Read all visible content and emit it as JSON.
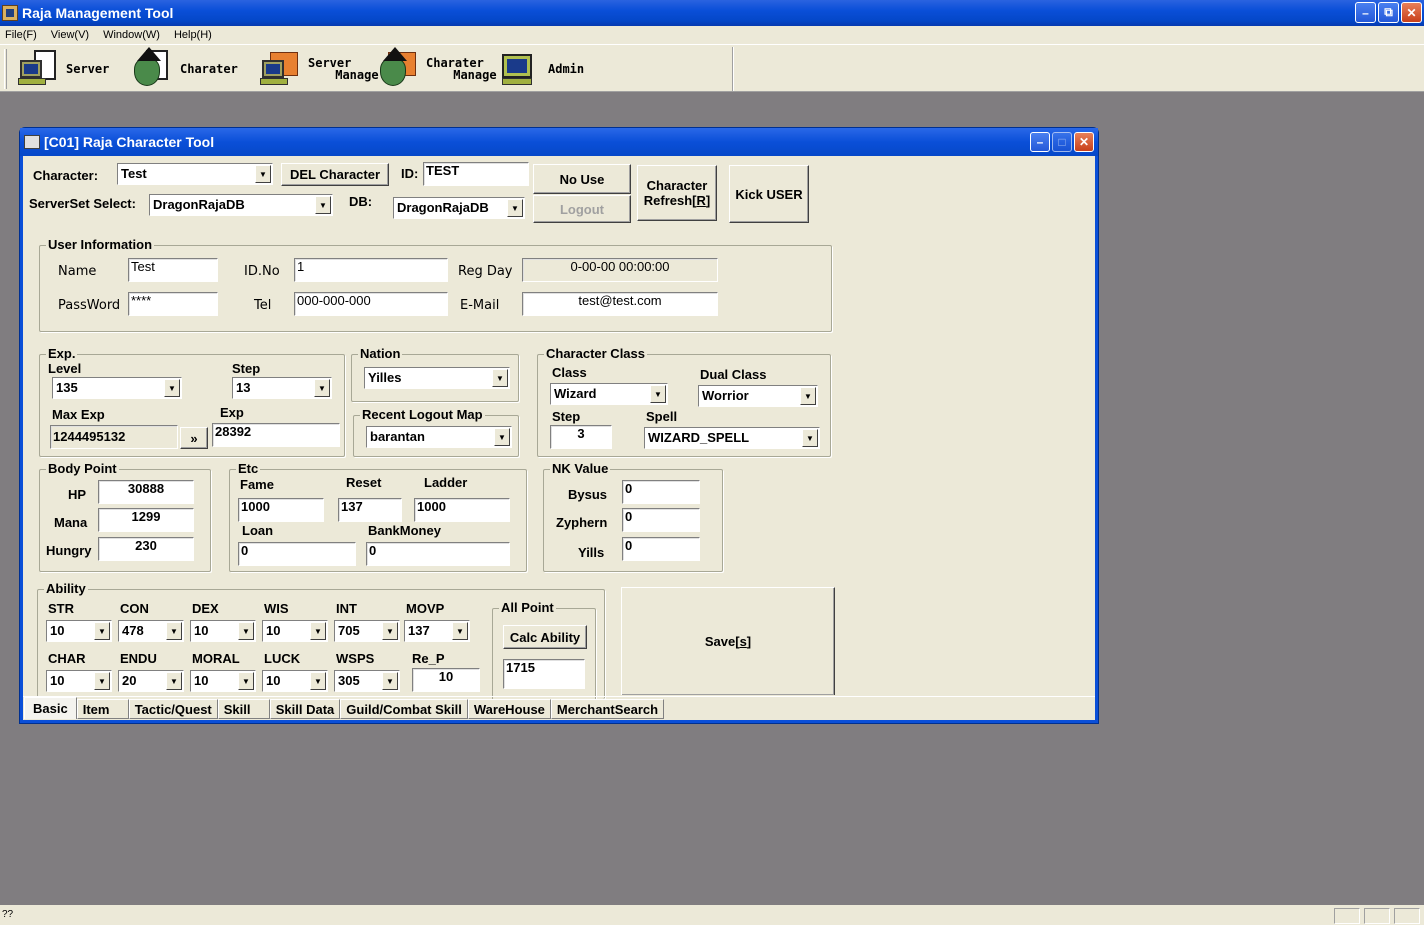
{
  "app": {
    "title": "Raja Management Tool",
    "window_buttons": {
      "minimize": "–",
      "restore": "⧉",
      "close": "✕"
    }
  },
  "menu": [
    "File(F)",
    "View(V)",
    "Window(W)",
    "Help(H)"
  ],
  "toolbar": [
    {
      "label": "Server",
      "icon": "server-computer-icon"
    },
    {
      "label": "Charater",
      "icon": "witch-document-icon"
    },
    {
      "label": "Server\nManage",
      "line1": "Server",
      "line2": " Manage",
      "icon": "server-manage-icon"
    },
    {
      "label": "Charater\nManage",
      "line1": "Charater",
      "line2": " Manage",
      "icon": "character-manage-icon"
    },
    {
      "label": "Admin",
      "icon": "admin-key-icon"
    }
  ],
  "child_window": {
    "title": "[C01] Raja Character Tool",
    "header": {
      "character_label": "Character:",
      "character_value": "Test",
      "del_character": "DEL Character",
      "id_label": "ID:",
      "id_value": "TEST",
      "no_use": "No Use",
      "logout": "Logout",
      "refresh_line1": "Character",
      "refresh_line2": "Refresh[",
      "refresh_key": "R",
      "refresh_end": "]",
      "kick_user": "Kick USER",
      "serverset_label": "ServerSet Select:",
      "serverset_value": "DragonRajaDB",
      "db_label": "DB:",
      "db_value": "DragonRajaDB"
    },
    "user_info": {
      "title": "User Information",
      "name_label": "Name",
      "name": "Test",
      "idno_label": "ID.No",
      "idno": "1",
      "regday_label": "Reg Day",
      "regday": "0-00-00 00:00:00",
      "password_label": "PassWord",
      "password": "****",
      "tel_label": "Tel",
      "tel": "000-000-000",
      "email_label": "E-Mail",
      "email": "test@test.com"
    },
    "exp": {
      "title": "Exp.",
      "level_label": "Level",
      "level": "135",
      "step_label": "Step",
      "step": "13",
      "maxexp_label": "Max Exp",
      "maxexp": "1244495132",
      "arrow_button": "»",
      "exp_label": "Exp",
      "exp": "28392"
    },
    "nation": {
      "title": "Nation",
      "value": "Yilles"
    },
    "logout_map": {
      "title": "Recent Logout Map",
      "value": "barantan"
    },
    "char_class": {
      "title": "Character Class",
      "class_label": "Class",
      "class": "Wizard",
      "dual_label": "Dual Class",
      "dual": "Worrior",
      "step_label": "Step",
      "step": "3",
      "spell_label": "Spell",
      "spell": "WIZARD_SPELL"
    },
    "body_point": {
      "title": "Body Point",
      "hp_label": "HP",
      "hp": "30888",
      "mana_label": "Mana",
      "mana": "1299",
      "hungry_label": "Hungry",
      "hungry": "230"
    },
    "etc": {
      "title": "Etc",
      "fame_label": "Fame",
      "fame": "1000",
      "reset_label": "Reset",
      "reset": "137",
      "ladder_label": "Ladder",
      "ladder": "1000",
      "loan_label": "Loan",
      "loan": "0",
      "bank_label": "BankMoney",
      "bank": "0"
    },
    "nk": {
      "title": "NK Value",
      "bysus_label": "Bysus",
      "bysus": "0",
      "zyphern_label": "Zyphern",
      "zyphern": "0",
      "yills_label": "Yills",
      "yills": "0"
    },
    "ability": {
      "title": "Ability",
      "row1": [
        {
          "label": "STR",
          "value": "10"
        },
        {
          "label": "CON",
          "value": "478"
        },
        {
          "label": "DEX",
          "value": "10"
        },
        {
          "label": "WIS",
          "value": "10"
        },
        {
          "label": "INT",
          "value": "705"
        },
        {
          "label": "MOVP",
          "value": "137"
        }
      ],
      "row2": [
        {
          "label": "CHAR",
          "value": "10"
        },
        {
          "label": "ENDU",
          "value": "20"
        },
        {
          "label": "MORAL",
          "value": "10"
        },
        {
          "label": "LUCK",
          "value": "10"
        },
        {
          "label": "WSPS",
          "value": "305"
        }
      ],
      "rep_label": "Re_P",
      "rep": "10"
    },
    "all_point": {
      "title": "All Point",
      "calc_button": "Calc Ability",
      "value": "1715"
    },
    "save": {
      "label": "Save[",
      "key": "s",
      "end": "]"
    },
    "tabs": [
      "Basic",
      "Item",
      "Tactic/Quest",
      "Skill",
      "Skill Data",
      "Guild/Combat Skill",
      "WareHouse",
      "MerchantSearch"
    ],
    "active_tab": "Basic"
  },
  "status_bar": {
    "text": "??"
  }
}
